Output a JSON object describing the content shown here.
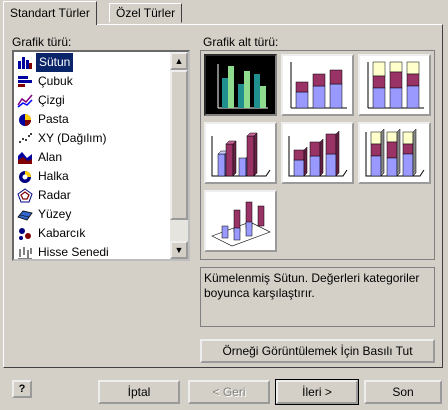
{
  "tabs": [
    {
      "label": "Standart Türler",
      "active": true
    },
    {
      "label": "Özel Türler",
      "active": false
    }
  ],
  "chart_type_label": "Grafik türü:",
  "chart_subtype_label": "Grafik alt türü:",
  "chart_types": [
    {
      "label": "Sütun",
      "icon": "column-chart-icon",
      "selected": true
    },
    {
      "label": "Çubuk",
      "icon": "bar-chart-icon"
    },
    {
      "label": "Çizgi",
      "icon": "line-chart-icon"
    },
    {
      "label": "Pasta",
      "icon": "pie-chart-icon"
    },
    {
      "label": "XY (Dağılım)",
      "icon": "scatter-chart-icon"
    },
    {
      "label": "Alan",
      "icon": "area-chart-icon"
    },
    {
      "label": "Halka",
      "icon": "doughnut-chart-icon"
    },
    {
      "label": "Radar",
      "icon": "radar-chart-icon"
    },
    {
      "label": "Yüzey",
      "icon": "surface-chart-icon"
    },
    {
      "label": "Kabarcık",
      "icon": "bubble-chart-icon"
    },
    {
      "label": "Hisse Senedi",
      "icon": "stock-chart-icon"
    }
  ],
  "subtypes": [
    {
      "icon": "clustered-column-icon",
      "selected": true
    },
    {
      "icon": "stacked-column-icon"
    },
    {
      "icon": "100-stacked-column-icon"
    },
    {
      "icon": "clustered-column-3d-effect-icon"
    },
    {
      "icon": "stacked-column-3d-effect-icon"
    },
    {
      "icon": "100-stacked-column-3d-effect-icon"
    },
    {
      "icon": "3d-column-icon"
    }
  ],
  "description": "Kümelenmiş Sütun. Değerleri kategoriler boyunca karşılaştırır.",
  "preview_button": "Örneği Görüntülemek İçin Basılı Tut",
  "help_button": "?",
  "buttons": {
    "cancel": "İptal",
    "back": "< Geri",
    "next": "İleri >",
    "finish": "Son"
  },
  "colors": {
    "face": "#d4d0c8",
    "selection": "#0a246a",
    "series1": "#9999ff",
    "series2": "#993366",
    "series3": "#ffffcc",
    "teal": "#1f8f8f",
    "green": "#8fdc8f"
  }
}
